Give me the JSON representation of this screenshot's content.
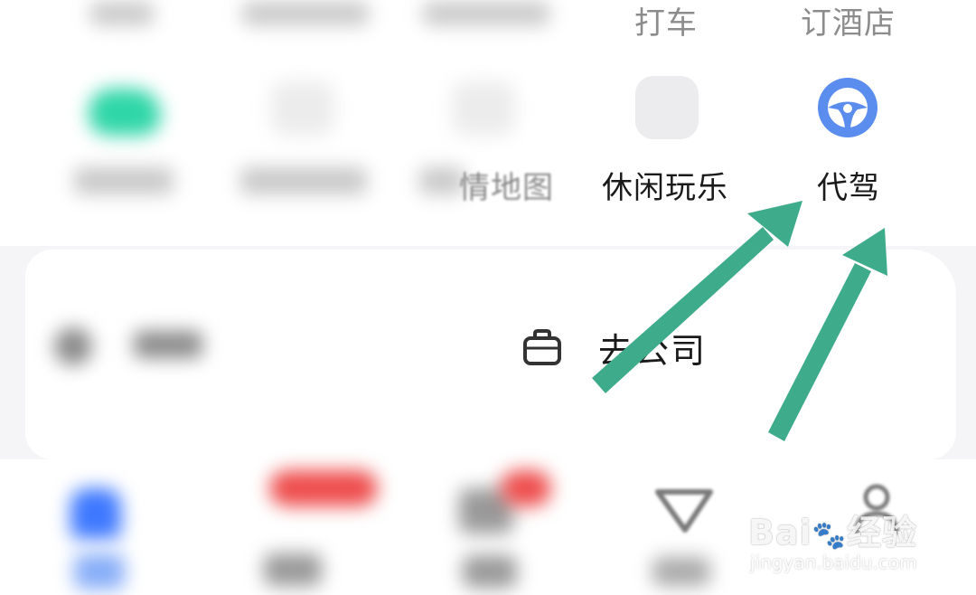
{
  "top_row": {
    "labels": [
      "打车",
      "订酒店"
    ]
  },
  "services": [
    {
      "label": "",
      "icon": "green-app-icon"
    },
    {
      "label": "",
      "icon": "blurred-app-icon"
    },
    {
      "label": "情地图",
      "icon": "blurred-app-icon"
    },
    {
      "label": "休闲玩乐",
      "icon": "leisure-icon"
    },
    {
      "label": "代驾",
      "icon": "steering-wheel-icon"
    }
  ],
  "card": {
    "company_label": "去公司",
    "company_icon": "briefcase-icon"
  },
  "watermark": {
    "brand_left": "Bai",
    "brand_right": "经验",
    "url": "jingyan.baidu.com"
  },
  "colors": {
    "accent_blue": "#5b8def",
    "arrow_green": "#3eab8a",
    "app_green": "#2fd6a8"
  }
}
